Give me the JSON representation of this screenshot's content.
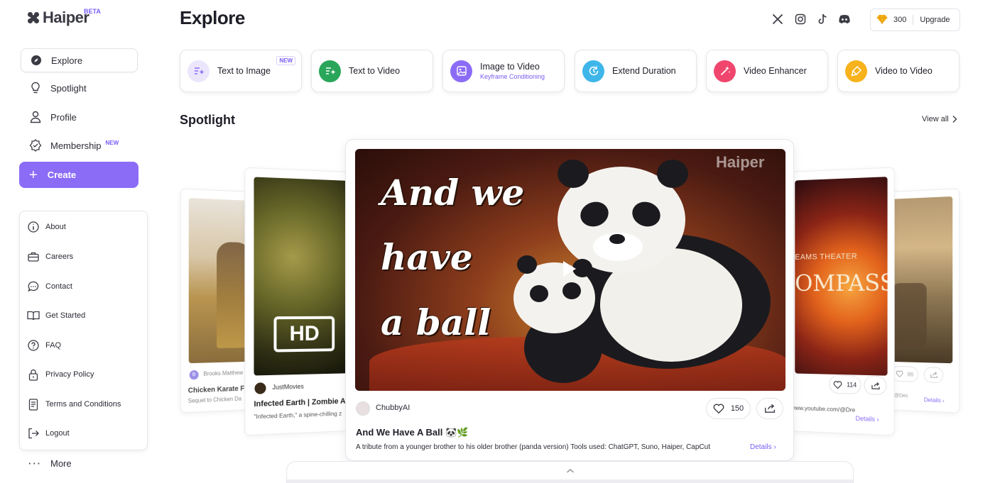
{
  "brand": {
    "name": "Haiper",
    "beta": "BETA"
  },
  "sidebar": {
    "items": [
      {
        "label": "Explore",
        "icon": "compass-icon"
      },
      {
        "label": "Spotlight",
        "icon": "lightbulb-icon"
      },
      {
        "label": "Profile",
        "icon": "user-icon"
      },
      {
        "label": "Membership",
        "icon": "badge-icon",
        "badge": "NEW"
      }
    ],
    "create_label": "Create",
    "menu": [
      {
        "label": "About",
        "icon": "info-icon"
      },
      {
        "label": "Careers",
        "icon": "briefcase-icon"
      },
      {
        "label": "Contact",
        "icon": "chat-icon"
      },
      {
        "label": "Get Started",
        "icon": "book-icon"
      },
      {
        "label": "FAQ",
        "icon": "question-icon"
      },
      {
        "label": "Privacy Policy",
        "icon": "lock-icon"
      },
      {
        "label": "Terms and Conditions",
        "icon": "document-icon"
      },
      {
        "label": "Logout",
        "icon": "logout-icon"
      }
    ],
    "more_label": "More"
  },
  "header": {
    "title": "Explore",
    "socials": [
      "x-icon",
      "instagram-icon",
      "tiktok-icon",
      "discord-icon"
    ],
    "credits": "300",
    "upgrade_label": "Upgrade"
  },
  "tools": [
    {
      "label": "Text to Image",
      "badge": "NEW",
      "color": "#ece6fd"
    },
    {
      "label": "Text to Video",
      "color": "#2aa65a"
    },
    {
      "label": "Image to Video",
      "sub": "Keyframe Conditioning",
      "color": "#8b6cf6"
    },
    {
      "label": "Extend Duration",
      "color": "#3fb6ea"
    },
    {
      "label": "Video Enhancer",
      "color": "#f0466e"
    },
    {
      "label": "Video to Video",
      "color": "#f7b21c"
    }
  ],
  "spotlight": {
    "title": "Spotlight",
    "view_all": "View all",
    "main": {
      "author": "ChubbyAI",
      "likes": "150",
      "title": "And We Have A Ball 🐼🌿",
      "description": "A tribute from a younger brother to his older brother (panda version) Tools used: ChatGPT, Suno, Haiper, CapCut",
      "details": "Details",
      "overlay_lines": [
        "And we",
        "have",
        "a ball"
      ],
      "watermark": "Haiper"
    },
    "left2": {
      "author": "JustMovies",
      "title": "Infected Earth | Zombie A",
      "desc": "\"Infected Earth,\" a spine-chilling z",
      "hd": "HD"
    },
    "left1": {
      "author": "Brooks Matthew",
      "author_initial": "B",
      "title": "Chicken Karate F",
      "desc": "Sequel to Chicken Da"
    },
    "right1": {
      "likes": "114",
      "link": "www.youtube.com/@Dre",
      "details": "Details",
      "poster_line1": "EAMS THEATER",
      "poster_line2": "OMPASS"
    },
    "right2": {
      "likes": "86",
      "link": "com/@Dec",
      "details": "Details"
    }
  }
}
